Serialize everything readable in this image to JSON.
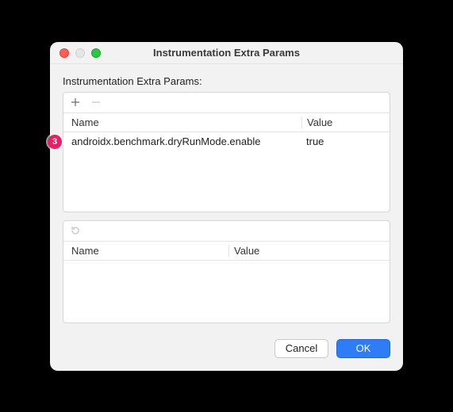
{
  "window": {
    "title": "Instrumentation Extra Params"
  },
  "section_label": "Instrumentation Extra Params:",
  "badge": "3",
  "top_table": {
    "headers": {
      "name": "Name",
      "value": "Value"
    },
    "rows": [
      {
        "name": "androidx.benchmark.dryRunMode.enable",
        "value": "true"
      }
    ]
  },
  "bottom_table": {
    "headers": {
      "name": "Name",
      "value": "Value"
    },
    "rows": []
  },
  "buttons": {
    "cancel": "Cancel",
    "ok": "OK"
  }
}
